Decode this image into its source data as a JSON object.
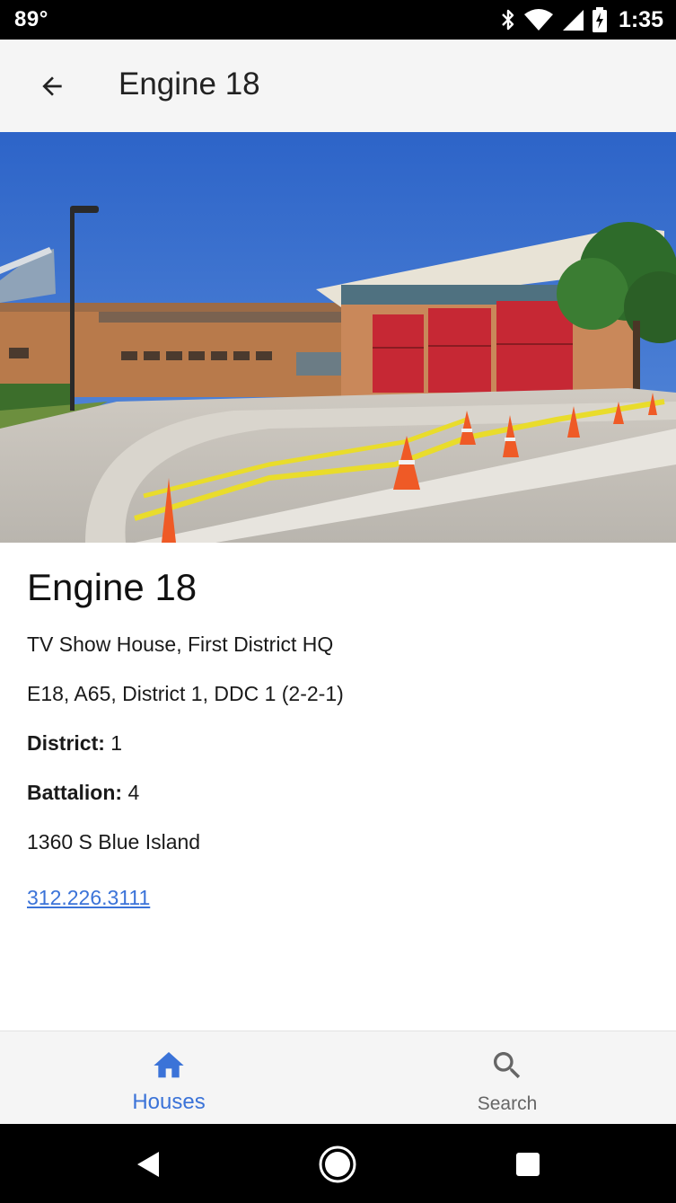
{
  "status_bar": {
    "temperature": "89°",
    "time": "1:35",
    "icons": [
      "bluetooth-icon",
      "wifi-icon",
      "cell-signal-icon",
      "battery-charging-icon"
    ]
  },
  "app_bar": {
    "title": "Engine 18",
    "back_icon": "arrow-back-icon"
  },
  "hero_image": {
    "description_icon": "firehouse-photo"
  },
  "station": {
    "name": "Engine 18",
    "description": "TV Show House, First District HQ",
    "units": "E18, A65, District 1, DDC 1 (2-2-1)",
    "district_label": "District:",
    "district_value": "1",
    "battalion_label": "Battalion:",
    "battalion_value": "4",
    "address": "1360 S Blue Island",
    "phone": "312.226.3111"
  },
  "bottom_nav": {
    "items": [
      {
        "label": "Houses",
        "icon": "home-icon",
        "active": true
      },
      {
        "label": "Search",
        "icon": "search-icon",
        "active": false
      }
    ]
  },
  "colors": {
    "accent": "#3b73d8",
    "app_bar_bg": "#f5f5f5",
    "inactive": "#666666"
  }
}
